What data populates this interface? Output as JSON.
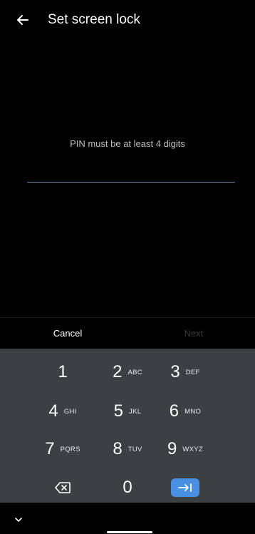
{
  "header": {
    "title": "Set screen lock"
  },
  "pin": {
    "hint": "PIN must be at least 4 digits",
    "value": ""
  },
  "actions": {
    "cancel_label": "Cancel",
    "next_label": "Next"
  },
  "keypad": {
    "keys": [
      {
        "digit": "1",
        "letters": ""
      },
      {
        "digit": "2",
        "letters": "ABC"
      },
      {
        "digit": "3",
        "letters": "DEF"
      },
      {
        "digit": "4",
        "letters": "GHI"
      },
      {
        "digit": "5",
        "letters": "JKL"
      },
      {
        "digit": "6",
        "letters": "MNO"
      },
      {
        "digit": "7",
        "letters": "PQRS"
      },
      {
        "digit": "8",
        "letters": "TUV"
      },
      {
        "digit": "9",
        "letters": "WXYZ"
      },
      {
        "digit": "0",
        "letters": ""
      }
    ],
    "background_color": "#3c4043",
    "enter_key_color": "#4a90e2"
  },
  "icons": {
    "back": "back-arrow-icon",
    "backspace": "backspace-icon",
    "enter": "tab-enter-icon",
    "collapse": "chevron-down-icon"
  }
}
